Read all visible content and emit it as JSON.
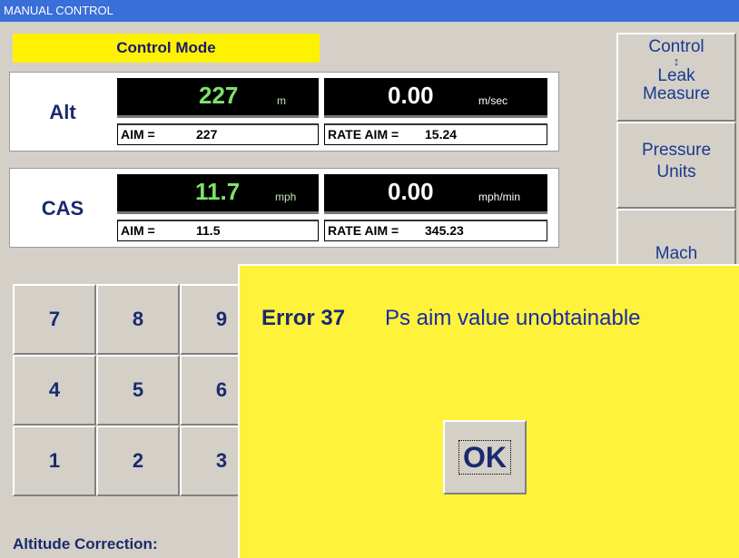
{
  "window": {
    "title": "MANUAL CONTROL"
  },
  "control_mode": {
    "label": "Control Mode"
  },
  "parameters": [
    {
      "name": "Alt",
      "value": "227",
      "unit": "m",
      "rate_value": "0.00",
      "rate_unit": "m/sec",
      "aim_label": "AIM =",
      "aim_value": "227",
      "rate_aim_label": "RATE AIM =",
      "rate_aim_value": "15.24"
    },
    {
      "name": "CAS",
      "value": "11.7",
      "unit": "mph",
      "rate_value": "0.00",
      "rate_unit": "mph/min",
      "aim_label": "AIM =",
      "aim_value": "11.5",
      "rate_aim_label": "RATE AIM =",
      "rate_aim_value": "345.23"
    }
  ],
  "side_buttons": {
    "control_label": "Control",
    "arrow_icon": "up-down-arrow-icon",
    "leak_label": "Leak",
    "measure_label": "Measure",
    "pressure_label": "Pressure",
    "units_label": "Units",
    "mach_label": "Mach"
  },
  "keypad": [
    "7",
    "8",
    "9",
    "4",
    "5",
    "6",
    "1",
    "2",
    "3"
  ],
  "footer": {
    "altitude_correction_label": "Altitude Correction:"
  },
  "dialog": {
    "error_code": "Error 37",
    "error_message": "Ps aim value unobtainable",
    "ok_label": "OK"
  },
  "colors": {
    "title_bar": "#3a6ed8",
    "mode_highlight": "#fff200",
    "dialog_background": "#fff23a",
    "readout_value": "#7de36a",
    "readout_unit": "#bfe6b4",
    "rate_value": "#ffffff"
  }
}
